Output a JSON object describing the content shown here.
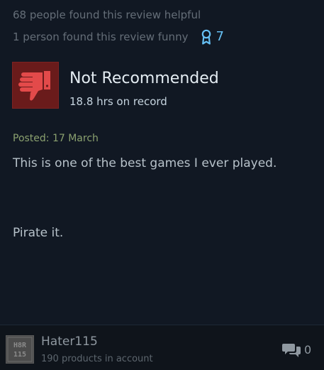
{
  "review": {
    "helpful_text": "68 people found this review helpful",
    "funny_text": "1 person found this review funny",
    "award_count": "7",
    "verdict": "Not Recommended",
    "hours": "18.8 hrs on record",
    "posted": "Posted: 17 March",
    "body_line1": "This is one of the best games I ever played.",
    "body_line2": "Pirate it."
  },
  "author": {
    "username": "Hater115",
    "products": "190 products in account",
    "avatar_text": "H8R 115"
  },
  "comments": {
    "count": "0"
  },
  "icons": {
    "award": "award-ribbon-icon",
    "thumb": "thumbs-down-icon",
    "comment": "comment-bubble-icon"
  },
  "colors": {
    "background": "#111823",
    "accent_blue": "#66c0f4",
    "not_recommended_bg": "#6a1b1b",
    "thumb_red": "#e34a4a",
    "posted_green": "#8ba16f"
  }
}
